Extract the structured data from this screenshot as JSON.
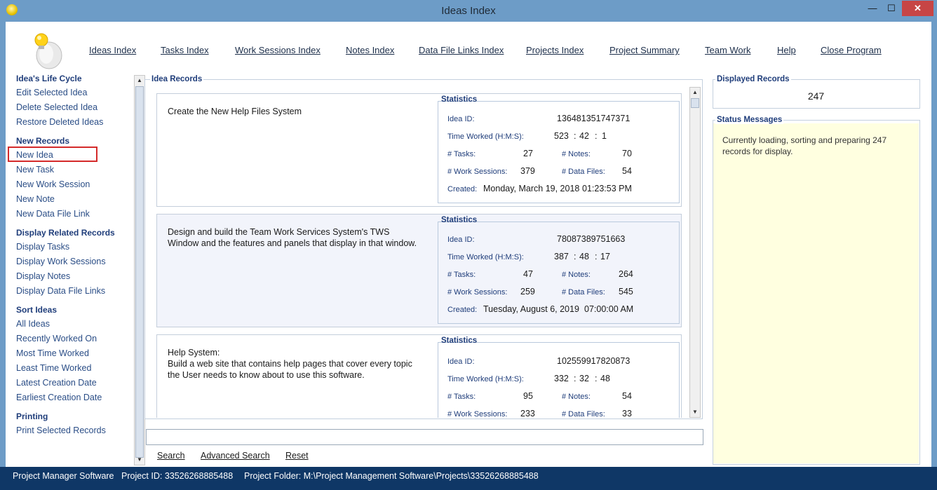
{
  "window": {
    "title": "Ideas Index",
    "min_glyph": "—",
    "max_glyph": "☐",
    "close_glyph": "✕"
  },
  "menu": [
    {
      "label": "Ideas Index"
    },
    {
      "label": "Tasks Index"
    },
    {
      "label": "Work Sessions Index"
    },
    {
      "label": "Notes Index"
    },
    {
      "label": "Data File Links Index"
    },
    {
      "label": "Projects Index"
    },
    {
      "label": "Project Summary"
    },
    {
      "label": "Team Work"
    },
    {
      "label": "Help"
    },
    {
      "label": "Close Program"
    }
  ],
  "sidebar": {
    "lifecycle": {
      "heading": "Idea's Life Cycle",
      "items": [
        "Edit Selected Idea",
        "Delete Selected Idea",
        "Restore Deleted Ideas"
      ]
    },
    "new_records": {
      "heading": "New Records",
      "items": [
        "New Idea",
        "New Task",
        "New Work Session",
        "New Note",
        "New Data File Link"
      ]
    },
    "related": {
      "heading": "Display Related Records",
      "items": [
        "Display Tasks",
        "Display Work Sessions",
        "Display Notes",
        "Display Data File Links"
      ]
    },
    "sort": {
      "heading": "Sort Ideas",
      "items": [
        "All Ideas",
        "Recently Worked On",
        "Most Time Worked",
        "Least Time Worked",
        "Latest Creation Date",
        "Earliest Creation Date"
      ]
    },
    "printing": {
      "heading": "Printing",
      "items": [
        "Print Selected Records"
      ]
    }
  },
  "records": {
    "heading": "Idea Records",
    "stats_labels": {
      "title": "Statistics",
      "id": "Idea ID:",
      "time": "Time Worked (H:M:S):",
      "tasks": "# Tasks:",
      "notes": "# Notes:",
      "sessions": "# Work Sessions:",
      "files": "# Data Files:",
      "created": "Created:",
      "sep": ":"
    },
    "items": [
      {
        "description": "Create the New Help Files System",
        "id": "136481351747371",
        "h": "523",
        "m": "42",
        "s": "1",
        "tasks": "27",
        "notes": "70",
        "sessions": "379",
        "files": "54",
        "created_date": "Monday, March 19, 2018",
        "created_time": "01:23:53 PM"
      },
      {
        "description": "Design and build the Team Work Services System's TWS\nWindow and the features and panels that display in that window.",
        "id": "78087389751663",
        "h": "387",
        "m": "48",
        "s": "17",
        "tasks": "47",
        "notes": "264",
        "sessions": "259",
        "files": "545",
        "created_date": "Tuesday, August 6, 2019",
        "created_time": "07:00:00 AM"
      },
      {
        "description": "Help System:\nBuild a web site that contains help pages that cover every topic\nthe User needs to know about to use this software.",
        "id": "102559917820873",
        "h": "332",
        "m": "32",
        "s": "48",
        "tasks": "95",
        "notes": "54",
        "sessions": "233",
        "files": "33"
      }
    ]
  },
  "search": {
    "value": "",
    "search_label": "Search",
    "advanced_label": "Advanced Search",
    "reset_label": "Reset"
  },
  "displayed": {
    "heading": "Displayed Records",
    "count": "247"
  },
  "status": {
    "heading": "Status Messages",
    "message": "Currently loading, sorting and preparing 247 records for display."
  },
  "statusbar": {
    "app": "Project Manager Software",
    "project_id": "Project ID:  33526268885488",
    "project_folder": "Project Folder: M:\\Project Management Software\\Projects\\33526268885488"
  },
  "colors": {
    "titlebar": "#6d9cc7",
    "statusbar": "#0f3766",
    "selection": "#d42a2a",
    "status_bg": "#ffffe0",
    "link": "#2a4d86"
  }
}
